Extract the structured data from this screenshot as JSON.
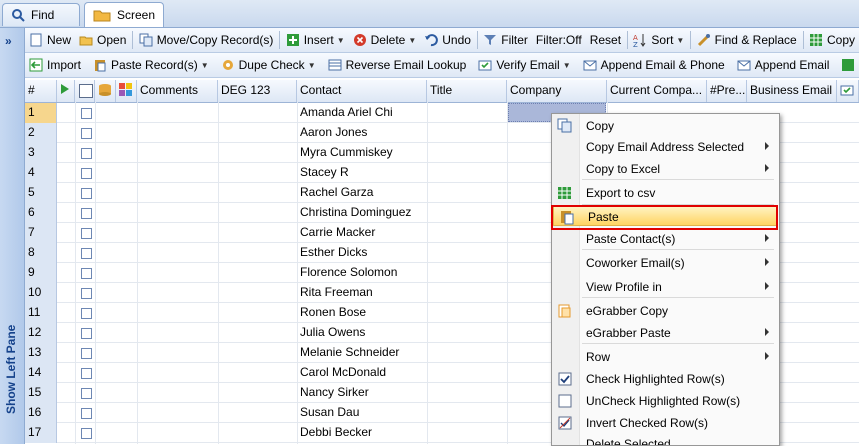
{
  "tabs": [
    {
      "label": "Find",
      "icon": "search-icon"
    },
    {
      "label": "Screen",
      "icon": "folder-icon"
    }
  ],
  "left_pane": {
    "label": "Show Left Pane"
  },
  "toolbar1": [
    {
      "label": "New",
      "icon": "new-doc-icon",
      "dropdown": false
    },
    {
      "label": "Open",
      "icon": "open-icon",
      "dropdown": false
    },
    {
      "label": "Move/Copy Record(s)",
      "icon": "move-copy-icon",
      "dropdown": false
    },
    {
      "label": "Insert",
      "icon": "insert-icon",
      "dropdown": true
    },
    {
      "label": "Delete",
      "icon": "delete-icon",
      "dropdown": true
    },
    {
      "label": "Undo",
      "icon": "undo-icon",
      "dropdown": false
    },
    {
      "label": "Filter",
      "icon": "filter-icon",
      "dropdown": false
    },
    {
      "label": "Filter:Off",
      "icon": "",
      "dropdown": false
    },
    {
      "label": "Reset",
      "icon": "",
      "dropdown": false
    },
    {
      "label": "Sort",
      "icon": "sort-icon",
      "dropdown": true
    },
    {
      "label": "Find & Replace",
      "icon": "find-replace-icon",
      "dropdown": false
    },
    {
      "label": "Copy",
      "icon": "copy-icon",
      "dropdown": false
    }
  ],
  "toolbar2": [
    {
      "label": "Import",
      "icon": "import-icon",
      "dropdown": false
    },
    {
      "label": "Paste Record(s)",
      "icon": "paste-record-icon",
      "dropdown": true
    },
    {
      "label": "Dupe Check",
      "icon": "dupe-check-icon",
      "dropdown": true
    },
    {
      "label": "Reverse Email Lookup",
      "icon": "reverse-lookup-icon",
      "dropdown": false
    },
    {
      "label": "Verify Email",
      "icon": "verify-email-icon",
      "dropdown": true
    },
    {
      "label": "Append Email & Phone",
      "icon": "append-email-phone-icon",
      "dropdown": false
    },
    {
      "label": "Append Email",
      "icon": "append-email-icon",
      "dropdown": false
    },
    {
      "label": "A",
      "icon": "append-icon",
      "dropdown": false
    }
  ],
  "grid": {
    "headers": [
      "#",
      "Comments",
      "DEG 123",
      "Contact",
      "Title",
      "Company",
      "Current Compa...",
      "#Pre...",
      "Business Email"
    ],
    "rows": [
      {
        "n": "1",
        "contact": "Amanda Ariel Chi"
      },
      {
        "n": "2",
        "contact": "Aaron Jones"
      },
      {
        "n": "3",
        "contact": "Myra Cummiskey"
      },
      {
        "n": "4",
        "contact": "Stacey R"
      },
      {
        "n": "5",
        "contact": "Rachel Garza"
      },
      {
        "n": "6",
        "contact": "Christina Dominguez"
      },
      {
        "n": "7",
        "contact": "Carrie Macker"
      },
      {
        "n": "8",
        "contact": "Esther Dicks"
      },
      {
        "n": "9",
        "contact": "Florence Solomon"
      },
      {
        "n": "10",
        "contact": "Rita Freeman"
      },
      {
        "n": "11",
        "contact": "Ronen Bose"
      },
      {
        "n": "12",
        "contact": "Julia Owens"
      },
      {
        "n": "13",
        "contact": "Melanie Schneider"
      },
      {
        "n": "14",
        "contact": "Carol McDonald"
      },
      {
        "n": "15",
        "contact": "Nancy Sirker"
      },
      {
        "n": "16",
        "contact": "Susan Dau"
      },
      {
        "n": "17",
        "contact": "Debbi Becker"
      }
    ]
  },
  "context_menu": {
    "items": [
      {
        "label": "Copy",
        "icon": "copy-icon",
        "submenu": false
      },
      {
        "label": "Copy Email Address Selected",
        "icon": "",
        "submenu": true
      },
      {
        "label": "Copy to Excel",
        "icon": "",
        "submenu": true
      },
      {
        "label": "Export to csv",
        "icon": "csv-icon",
        "submenu": false
      },
      {
        "label": "Paste",
        "icon": "paste-icon",
        "submenu": false,
        "highlighted": true
      },
      {
        "label": "Paste Contact(s)",
        "icon": "",
        "submenu": true
      },
      {
        "label": "Coworker Email(s)",
        "icon": "",
        "submenu": true
      },
      {
        "label": "View Profile in",
        "icon": "",
        "submenu": true
      },
      {
        "label": "eGrabber Copy",
        "icon": "egrabber-copy-icon",
        "submenu": false
      },
      {
        "label": "eGrabber Paste",
        "icon": "",
        "submenu": true
      },
      {
        "label": "Row",
        "icon": "",
        "submenu": true
      },
      {
        "label": "Check Highlighted Row(s)",
        "icon": "checkbox-checked-icon",
        "submenu": false
      },
      {
        "label": "UnCheck Highlighted Row(s)",
        "icon": "checkbox-unchecked-icon",
        "submenu": false
      },
      {
        "label": "Invert Checked Row(s)",
        "icon": "invert-check-icon",
        "submenu": false
      },
      {
        "label": "Delete Selected",
        "icon": "",
        "submenu": false
      }
    ]
  }
}
